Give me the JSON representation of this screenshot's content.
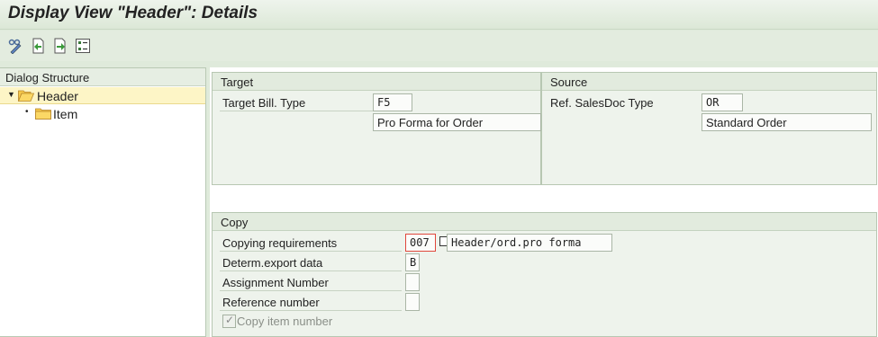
{
  "window": {
    "title": "Display View \"Header\": Details"
  },
  "toolbar": {
    "icons": [
      "display-change-icon",
      "previous-entry-icon",
      "next-entry-icon",
      "variable-list-icon"
    ]
  },
  "dialog_structure": {
    "header": "Dialog Structure",
    "items": [
      {
        "label": "Header",
        "expanded": true,
        "selected": true
      },
      {
        "label": "Item",
        "expanded": false,
        "selected": false
      }
    ]
  },
  "target": {
    "title": "Target",
    "bill_type_label": "Target Bill. Type",
    "bill_type_value": "F5",
    "bill_type_desc": "Pro Forma for Order"
  },
  "source": {
    "title": "Source",
    "salesdoc_type_label": "Ref. SalesDoc Type",
    "salesdoc_type_value": "OR",
    "salesdoc_type_desc": "Standard Order"
  },
  "copy": {
    "title": "Copy",
    "copying_req_label": "Copying requirements",
    "copying_req_value": "007",
    "copying_req_desc": "Header/ord.pro forma",
    "export_label": "Determ.export data",
    "export_value": "B",
    "assignment_label": "Assignment Number",
    "assignment_value": "",
    "reference_label": "Reference number",
    "reference_value": "",
    "copy_item_label": "Copy item number",
    "copy_item_checked": true
  },
  "colors": {
    "background": "#dfeadb",
    "selection": "#fdf5c6",
    "focus_marker": "#e0473c"
  }
}
